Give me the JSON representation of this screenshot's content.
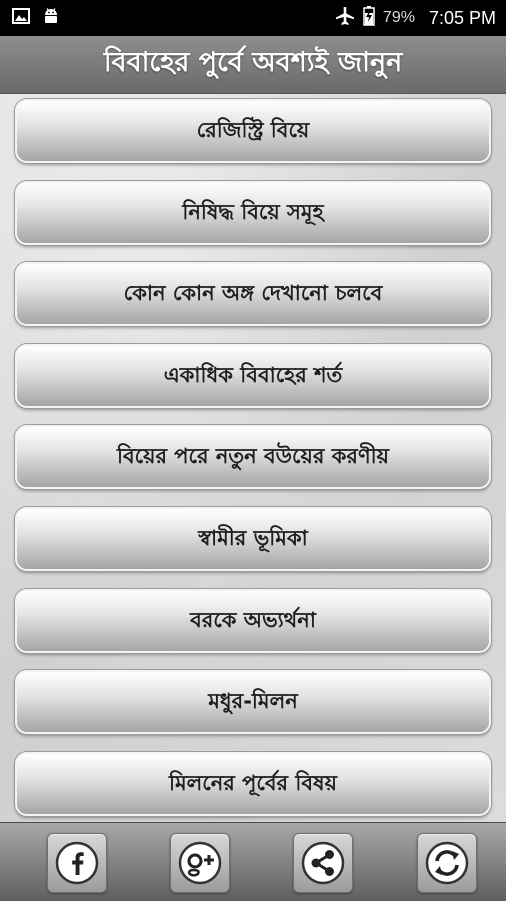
{
  "status_bar": {
    "battery_percent": "79%",
    "time": "7:05 PM",
    "left_icons": [
      "image-icon",
      "android-icon"
    ],
    "right_icons": [
      "airplane-mode-icon",
      "battery-charging-icon"
    ]
  },
  "header": {
    "title": "বিবাহের পুর্বে অবশ্যই জানুন"
  },
  "menu": {
    "items": [
      {
        "label": "রেজিস্ট্রি বিয়ে"
      },
      {
        "label": "নিষিদ্ধ বিয়ে সমূহ"
      },
      {
        "label": "কোন কোন অঙ্গ দেখানো চলবে"
      },
      {
        "label": "একাধিক বিবাহের শর্ত"
      },
      {
        "label": "বিয়ের পরে নতুন বউয়ের করণীয়"
      },
      {
        "label": "স্বামীর ভূমিকা"
      },
      {
        "label": "বরকে অভ্যর্থনা"
      },
      {
        "label": "মধুর-মিলন"
      },
      {
        "label": "মিলনের পূর্বের বিষয়"
      }
    ]
  },
  "bottom_bar": {
    "buttons": [
      "facebook-icon",
      "google-plus-icon",
      "share-icon",
      "refresh-icon"
    ]
  },
  "colors": {
    "status_bar_bg": "#000000",
    "title_bar_bg": "#7a7a7a",
    "content_bg": "#d9d9d9",
    "button_text": "#1e1e1e"
  }
}
